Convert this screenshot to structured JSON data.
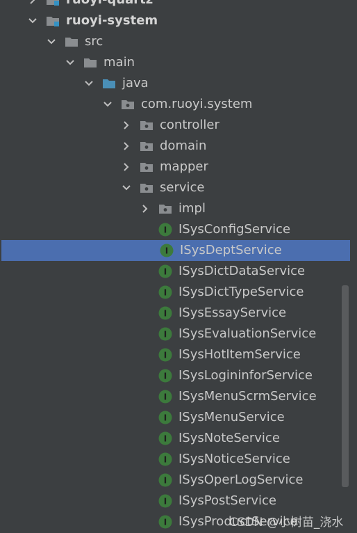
{
  "project_tree": {
    "nodes": [
      {
        "label": "ruoyi-quartz",
        "kind": "module",
        "expanded": false,
        "bold": true
      },
      {
        "label": "ruoyi-system",
        "kind": "module",
        "expanded": true,
        "bold": true
      },
      {
        "label": "src",
        "kind": "folder",
        "expanded": true
      },
      {
        "label": "main",
        "kind": "folder",
        "expanded": true
      },
      {
        "label": "java",
        "kind": "source-folder",
        "expanded": true
      },
      {
        "label": "com.ruoyi.system",
        "kind": "package",
        "expanded": true
      },
      {
        "label": "controller",
        "kind": "package",
        "expanded": false
      },
      {
        "label": "domain",
        "kind": "package",
        "expanded": false
      },
      {
        "label": "mapper",
        "kind": "package",
        "expanded": false
      },
      {
        "label": "service",
        "kind": "package",
        "expanded": true
      },
      {
        "label": "impl",
        "kind": "package",
        "expanded": false
      },
      {
        "label": "ISysConfigService",
        "kind": "interface"
      },
      {
        "label": "ISysDeptService",
        "kind": "interface",
        "selected": true
      },
      {
        "label": "ISysDictDataService",
        "kind": "interface"
      },
      {
        "label": "ISysDictTypeService",
        "kind": "interface"
      },
      {
        "label": "ISysEssayService",
        "kind": "interface"
      },
      {
        "label": "ISysEvaluationService",
        "kind": "interface"
      },
      {
        "label": "ISysHotItemService",
        "kind": "interface"
      },
      {
        "label": "ISysLogininforService",
        "kind": "interface"
      },
      {
        "label": "ISysMenuScrmService",
        "kind": "interface"
      },
      {
        "label": "ISysMenuService",
        "kind": "interface"
      },
      {
        "label": "ISysNoteService",
        "kind": "interface"
      },
      {
        "label": "ISysNoticeService",
        "kind": "interface"
      },
      {
        "label": "ISysOperLogService",
        "kind": "interface"
      },
      {
        "label": "ISysPostService",
        "kind": "interface"
      },
      {
        "label": "ISysProductService",
        "kind": "interface"
      }
    ],
    "interface_icon_letter": "I"
  },
  "watermark": "CSDN @小树苗_浇水",
  "colors": {
    "background": "#3c3f41",
    "selection": "#4b6eaf",
    "text": "#c8c8c8",
    "interface_icon": "#3c7a3c",
    "folder": "#8a8d90",
    "module_badge": "#3592c4",
    "source_folder": "#4a8fb7"
  }
}
